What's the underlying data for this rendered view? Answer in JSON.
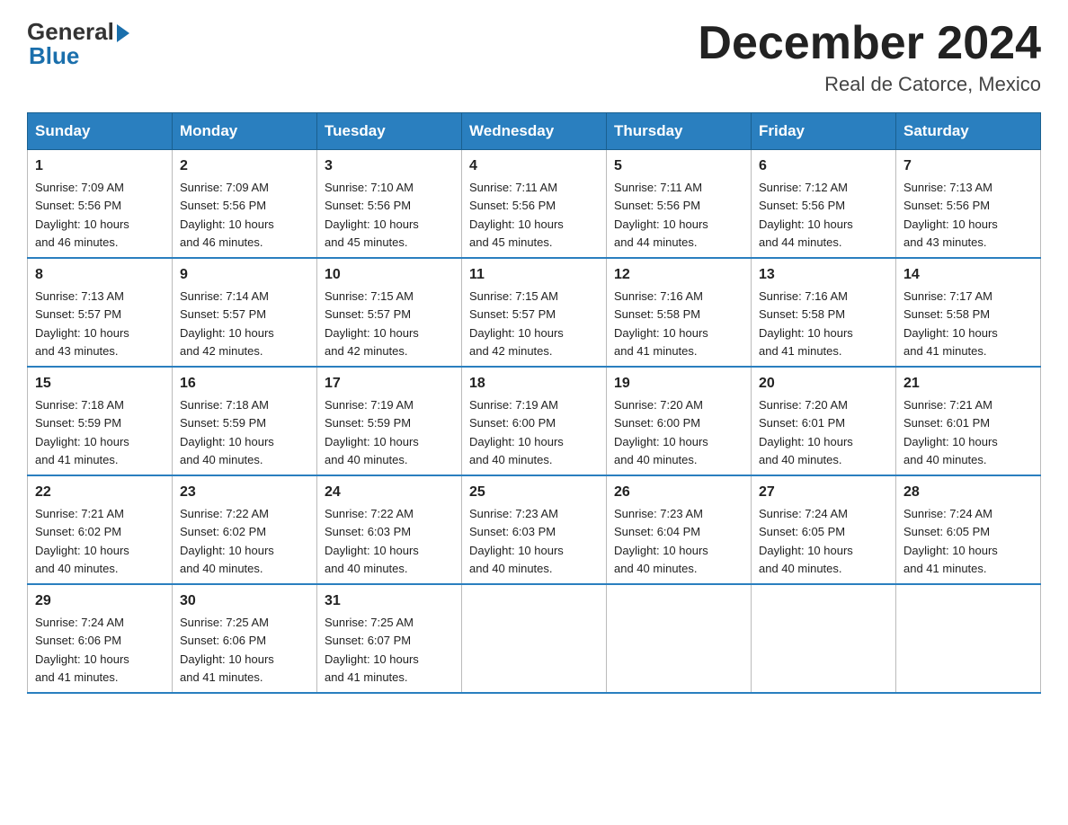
{
  "logo": {
    "general": "General",
    "blue": "Blue"
  },
  "title": "December 2024",
  "subtitle": "Real de Catorce, Mexico",
  "days_of_week": [
    "Sunday",
    "Monday",
    "Tuesday",
    "Wednesday",
    "Thursday",
    "Friday",
    "Saturday"
  ],
  "weeks": [
    [
      {
        "day": "1",
        "sunrise": "7:09 AM",
        "sunset": "5:56 PM",
        "daylight": "10 hours and 46 minutes."
      },
      {
        "day": "2",
        "sunrise": "7:09 AM",
        "sunset": "5:56 PM",
        "daylight": "10 hours and 46 minutes."
      },
      {
        "day": "3",
        "sunrise": "7:10 AM",
        "sunset": "5:56 PM",
        "daylight": "10 hours and 45 minutes."
      },
      {
        "day": "4",
        "sunrise": "7:11 AM",
        "sunset": "5:56 PM",
        "daylight": "10 hours and 45 minutes."
      },
      {
        "day": "5",
        "sunrise": "7:11 AM",
        "sunset": "5:56 PM",
        "daylight": "10 hours and 44 minutes."
      },
      {
        "day": "6",
        "sunrise": "7:12 AM",
        "sunset": "5:56 PM",
        "daylight": "10 hours and 44 minutes."
      },
      {
        "day": "7",
        "sunrise": "7:13 AM",
        "sunset": "5:56 PM",
        "daylight": "10 hours and 43 minutes."
      }
    ],
    [
      {
        "day": "8",
        "sunrise": "7:13 AM",
        "sunset": "5:57 PM",
        "daylight": "10 hours and 43 minutes."
      },
      {
        "day": "9",
        "sunrise": "7:14 AM",
        "sunset": "5:57 PM",
        "daylight": "10 hours and 42 minutes."
      },
      {
        "day": "10",
        "sunrise": "7:15 AM",
        "sunset": "5:57 PM",
        "daylight": "10 hours and 42 minutes."
      },
      {
        "day": "11",
        "sunrise": "7:15 AM",
        "sunset": "5:57 PM",
        "daylight": "10 hours and 42 minutes."
      },
      {
        "day": "12",
        "sunrise": "7:16 AM",
        "sunset": "5:58 PM",
        "daylight": "10 hours and 41 minutes."
      },
      {
        "day": "13",
        "sunrise": "7:16 AM",
        "sunset": "5:58 PM",
        "daylight": "10 hours and 41 minutes."
      },
      {
        "day": "14",
        "sunrise": "7:17 AM",
        "sunset": "5:58 PM",
        "daylight": "10 hours and 41 minutes."
      }
    ],
    [
      {
        "day": "15",
        "sunrise": "7:18 AM",
        "sunset": "5:59 PM",
        "daylight": "10 hours and 41 minutes."
      },
      {
        "day": "16",
        "sunrise": "7:18 AM",
        "sunset": "5:59 PM",
        "daylight": "10 hours and 40 minutes."
      },
      {
        "day": "17",
        "sunrise": "7:19 AM",
        "sunset": "5:59 PM",
        "daylight": "10 hours and 40 minutes."
      },
      {
        "day": "18",
        "sunrise": "7:19 AM",
        "sunset": "6:00 PM",
        "daylight": "10 hours and 40 minutes."
      },
      {
        "day": "19",
        "sunrise": "7:20 AM",
        "sunset": "6:00 PM",
        "daylight": "10 hours and 40 minutes."
      },
      {
        "day": "20",
        "sunrise": "7:20 AM",
        "sunset": "6:01 PM",
        "daylight": "10 hours and 40 minutes."
      },
      {
        "day": "21",
        "sunrise": "7:21 AM",
        "sunset": "6:01 PM",
        "daylight": "10 hours and 40 minutes."
      }
    ],
    [
      {
        "day": "22",
        "sunrise": "7:21 AM",
        "sunset": "6:02 PM",
        "daylight": "10 hours and 40 minutes."
      },
      {
        "day": "23",
        "sunrise": "7:22 AM",
        "sunset": "6:02 PM",
        "daylight": "10 hours and 40 minutes."
      },
      {
        "day": "24",
        "sunrise": "7:22 AM",
        "sunset": "6:03 PM",
        "daylight": "10 hours and 40 minutes."
      },
      {
        "day": "25",
        "sunrise": "7:23 AM",
        "sunset": "6:03 PM",
        "daylight": "10 hours and 40 minutes."
      },
      {
        "day": "26",
        "sunrise": "7:23 AM",
        "sunset": "6:04 PM",
        "daylight": "10 hours and 40 minutes."
      },
      {
        "day": "27",
        "sunrise": "7:24 AM",
        "sunset": "6:05 PM",
        "daylight": "10 hours and 40 minutes."
      },
      {
        "day": "28",
        "sunrise": "7:24 AM",
        "sunset": "6:05 PM",
        "daylight": "10 hours and 41 minutes."
      }
    ],
    [
      {
        "day": "29",
        "sunrise": "7:24 AM",
        "sunset": "6:06 PM",
        "daylight": "10 hours and 41 minutes."
      },
      {
        "day": "30",
        "sunrise": "7:25 AM",
        "sunset": "6:06 PM",
        "daylight": "10 hours and 41 minutes."
      },
      {
        "day": "31",
        "sunrise": "7:25 AM",
        "sunset": "6:07 PM",
        "daylight": "10 hours and 41 minutes."
      },
      null,
      null,
      null,
      null
    ]
  ],
  "labels": {
    "sunrise": "Sunrise:",
    "sunset": "Sunset:",
    "daylight": "Daylight:"
  }
}
